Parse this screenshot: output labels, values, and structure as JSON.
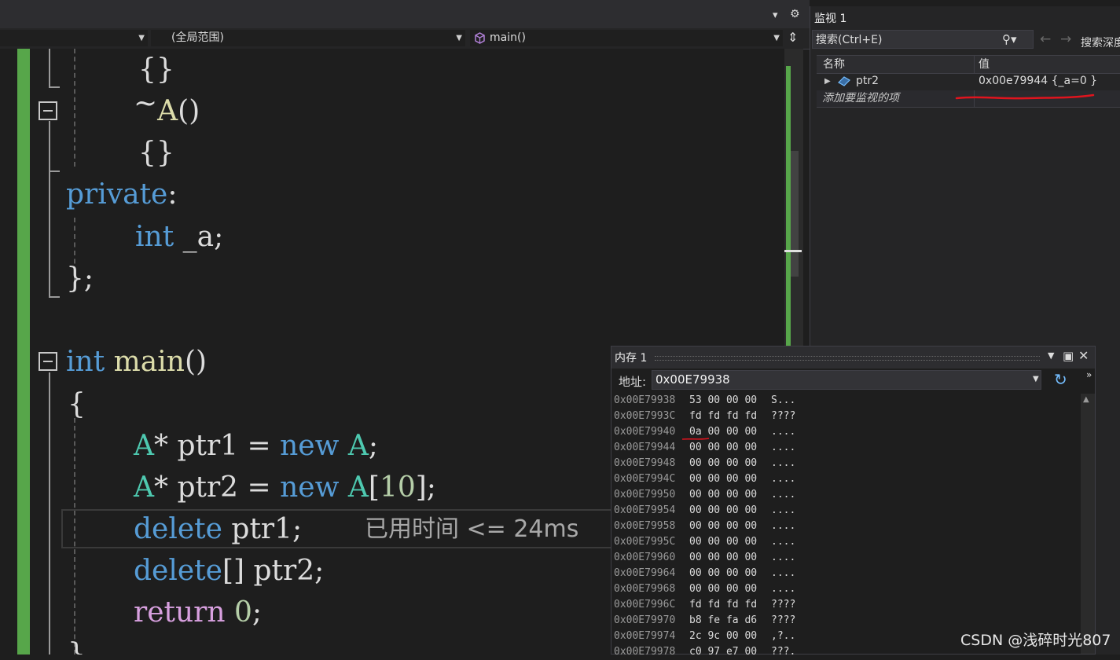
{
  "toolbar": {
    "gear_glyph": "⚙",
    "dropdown_glyph": "▾",
    "split_glyph": "⇕"
  },
  "navbar": {
    "scope": "(全局范围)",
    "member": "main()"
  },
  "code": {
    "line1": "{}",
    "line2_tilde": "~",
    "line2_name": "A",
    "line2_parens": "()",
    "line3": "{}",
    "line4_kw": "private",
    "line4_colon": ":",
    "line5_type": "int",
    "line5_rest": " _a;",
    "line6": "};",
    "main_type": "int",
    "main_name": "main",
    "main_parens": "()",
    "open_brace": "{",
    "l1_type": "A",
    "l1_rest": "* ptr1 = ",
    "l1_new": "new",
    "l1_type2": "A",
    "l1_end": ";",
    "l2_type": "A",
    "l2_rest": "* ptr2 = ",
    "l2_new": "new",
    "l2_type2": "A",
    "l2_bracket_open": "[",
    "l2_num": "10",
    "l2_end": "];",
    "l3_kw": "delete",
    "l3_rest": " ptr1;",
    "l4_kw": "delete",
    "l4_rest": "[] ptr2;",
    "l5_kw": "return",
    "l5_num": "0",
    "l5_end": ";",
    "close_brace": "}"
  },
  "perf_tip": "已用时间 <= 24ms",
  "watch": {
    "title": "监视 1",
    "search_placeholder": "搜索(Ctrl+E)",
    "search_depth": "搜索深度",
    "col_name": "名称",
    "col_value": "值",
    "rows": [
      {
        "name": "ptr2",
        "value": "0x00e79944 {_a=0 }"
      }
    ],
    "add_item": "添加要监视的项",
    "back_arrow": "←",
    "forward_arrow": "→"
  },
  "memory": {
    "title": "内存 1",
    "address_label": "地址:",
    "address": "0x00E79938",
    "rows": [
      {
        "addr": "0x00E79938",
        "hex": "53 00 00 00",
        "chars": "S..."
      },
      {
        "addr": "0x00E7993C",
        "hex": "fd fd fd fd",
        "chars": "????"
      },
      {
        "addr": "0x00E79940",
        "hex": "0a 00 00 00",
        "chars": "...."
      },
      {
        "addr": "0x00E79944",
        "hex": "00 00 00 00",
        "chars": "...."
      },
      {
        "addr": "0x00E79948",
        "hex": "00 00 00 00",
        "chars": "...."
      },
      {
        "addr": "0x00E7994C",
        "hex": "00 00 00 00",
        "chars": "...."
      },
      {
        "addr": "0x00E79950",
        "hex": "00 00 00 00",
        "chars": "...."
      },
      {
        "addr": "0x00E79954",
        "hex": "00 00 00 00",
        "chars": "...."
      },
      {
        "addr": "0x00E79958",
        "hex": "00 00 00 00",
        "chars": "...."
      },
      {
        "addr": "0x00E7995C",
        "hex": "00 00 00 00",
        "chars": "...."
      },
      {
        "addr": "0x00E79960",
        "hex": "00 00 00 00",
        "chars": "...."
      },
      {
        "addr": "0x00E79964",
        "hex": "00 00 00 00",
        "chars": "...."
      },
      {
        "addr": "0x00E79968",
        "hex": "00 00 00 00",
        "chars": "...."
      },
      {
        "addr": "0x00E7996C",
        "hex": "fd fd fd fd",
        "chars": "????"
      },
      {
        "addr": "0x00E79970",
        "hex": "b8 fe fa d6",
        "chars": "????"
      },
      {
        "addr": "0x00E79974",
        "hex": "2c 9c 00 00",
        "chars": ",?.."
      },
      {
        "addr": "0x00E79978",
        "hex": "c0 97 e7 00",
        "chars": "???."
      }
    ]
  },
  "watermark": "CSDN @浅碎时光807",
  "colors": {
    "keyword": "#569cd6",
    "type": "#4ec9b0",
    "function": "#dcdcaa",
    "control": "#d8a0df",
    "number": "#b5cea8",
    "annotation_red": "#e0141e",
    "change_bar": "#57a64a"
  }
}
